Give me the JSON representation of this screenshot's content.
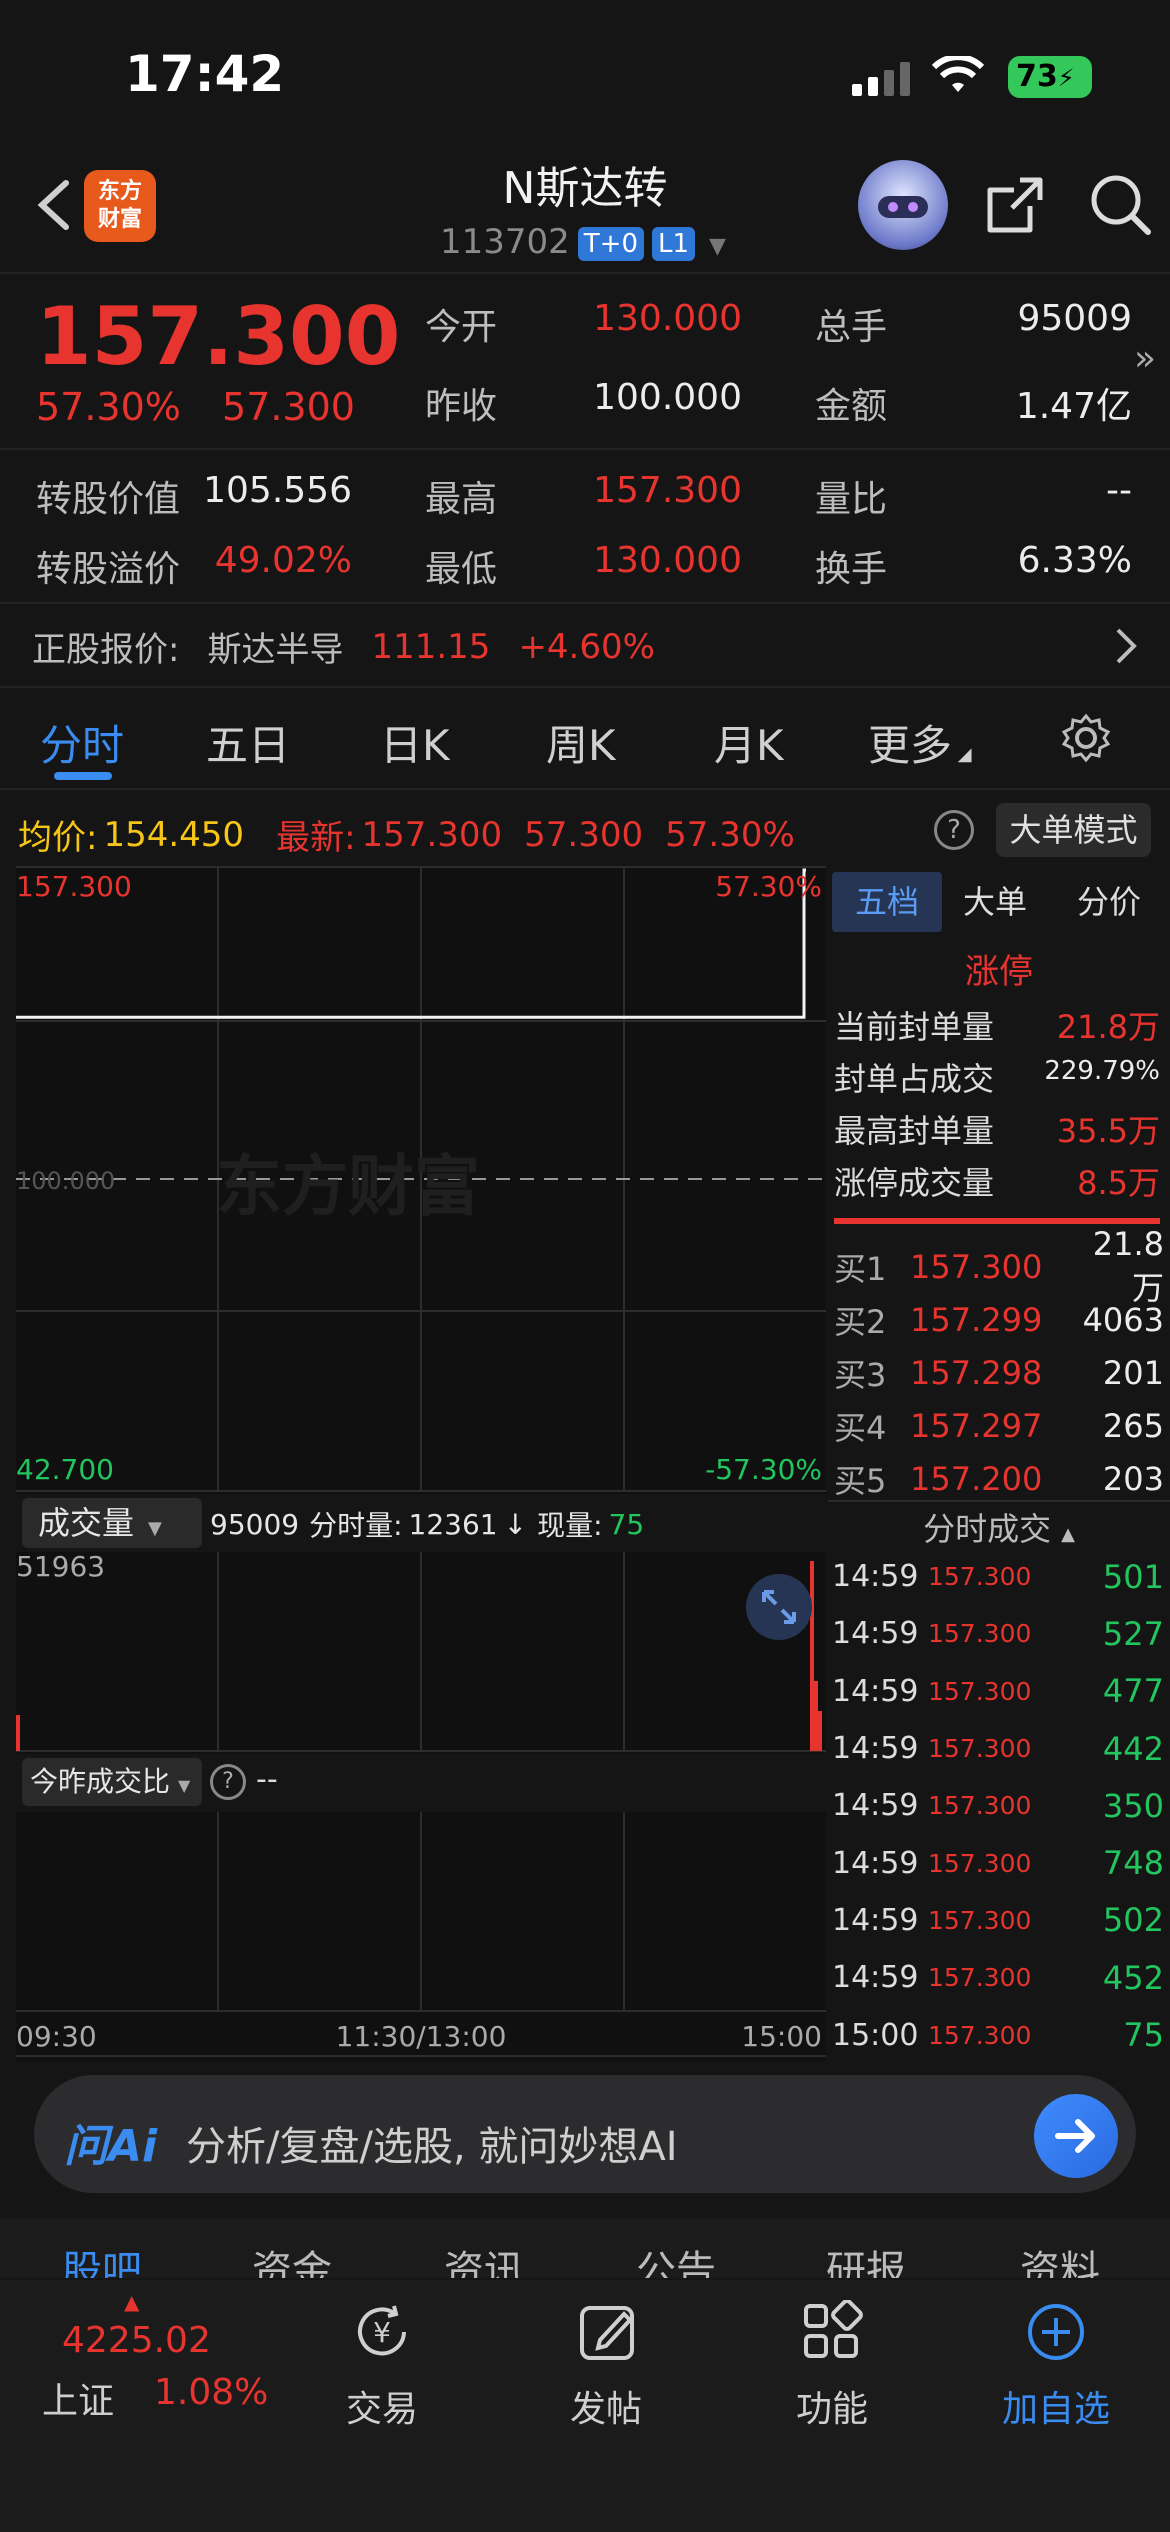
{
  "status": {
    "time": "17:42",
    "battery": "73"
  },
  "header": {
    "title": "N斯达转",
    "code": "113702",
    "tag1": "T+0",
    "tag2": "L1",
    "logo_line1": "东方",
    "logo_line2": "财富"
  },
  "quote": {
    "price": "157.300",
    "change_pct": "57.30%",
    "change_amt": "57.300",
    "open_label": "今开",
    "open": "130.000",
    "total_vol_label": "总手",
    "total_vol": "95009",
    "prev_close_label": "昨收",
    "prev_close": "100.000",
    "amount_label": "金额",
    "amount": "1.47亿",
    "conv_value_label": "转股价值",
    "conv_value": "105.556",
    "high_label": "最高",
    "high": "157.300",
    "vol_ratio_label": "量比",
    "vol_ratio": "--",
    "premium_label": "转股溢价",
    "premium": "49.02%",
    "low_label": "最低",
    "low": "130.000",
    "turnover_label": "换手",
    "turnover": "6.33%"
  },
  "underlying": {
    "label": "正股报价:",
    "name": "斯达半导",
    "price": "111.15",
    "change": "+4.60%"
  },
  "tabs": [
    "分时",
    "五日",
    "日K",
    "周K",
    "月K",
    "更多"
  ],
  "infoline": {
    "avg_label": "均价:",
    "avg": "154.450",
    "latest_label": "最新:",
    "latest": "157.300",
    "chg": "57.300",
    "pct": "57.30%",
    "mode_btn": "大单模式"
  },
  "chart": {
    "top_price": "157.300",
    "top_pct": "57.30%",
    "bottom_price": "42.700",
    "bottom_pct": "-57.30%",
    "mid_price": "100.000",
    "watermark": "东方财富",
    "vol_selector": "成交量",
    "vol_total": "95009",
    "vol_min_label": "分时量:",
    "vol_min": "12361",
    "vol_now_label": "现量:",
    "vol_now": "75",
    "vol_max": "51963",
    "ratio_selector": "今昨成交比",
    "ratio_value": "--",
    "time_start": "09:30",
    "time_mid": "11:30/13:00",
    "time_end": "15:00"
  },
  "chart_data": {
    "type": "line",
    "title": "",
    "x": [
      "09:30",
      "11:30/13:00",
      "15:00"
    ],
    "series": [
      {
        "values": [
          130.0,
          130.0,
          157.3
        ]
      }
    ],
    "ylim": [
      42.7,
      157.3
    ]
  },
  "right": {
    "seg1": "五档",
    "seg2": "大单",
    "seg3": "分价",
    "limit_title": "涨停",
    "seal_label": "当前封单量",
    "seal": "21.8万",
    "seal_ratio_label": "封单占成交",
    "seal_ratio": "229.79%",
    "max_seal_label": "最高封单量",
    "max_seal": "35.5万",
    "limit_vol_label": "涨停成交量",
    "limit_vol": "8.5万",
    "bids": [
      {
        "label": "买1",
        "price": "157.300",
        "vol": "21.8万"
      },
      {
        "label": "买2",
        "price": "157.299",
        "vol": "4063"
      },
      {
        "label": "买3",
        "price": "157.298",
        "vol": "201"
      },
      {
        "label": "买4",
        "price": "157.297",
        "vol": "265"
      },
      {
        "label": "买5",
        "price": "157.200",
        "vol": "203"
      }
    ],
    "ticks_title": "分时成交",
    "ticks": [
      {
        "t": "14:59",
        "p": "157.300",
        "v": "501"
      },
      {
        "t": "14:59",
        "p": "157.300",
        "v": "527"
      },
      {
        "t": "14:59",
        "p": "157.300",
        "v": "477"
      },
      {
        "t": "14:59",
        "p": "157.300",
        "v": "442"
      },
      {
        "t": "14:59",
        "p": "157.300",
        "v": "350"
      },
      {
        "t": "14:59",
        "p": "157.300",
        "v": "748"
      },
      {
        "t": "14:59",
        "p": "157.300",
        "v": "502"
      },
      {
        "t": "14:59",
        "p": "157.300",
        "v": "452"
      },
      {
        "t": "15:00",
        "p": "157.300",
        "v": "75"
      }
    ]
  },
  "ai": {
    "logo": "问Ai",
    "placeholder": "分析/复盘/选股, 就问妙想AI"
  },
  "botnav": [
    "股吧",
    "资金",
    "资讯",
    "公告",
    "研报",
    "资料"
  ],
  "bottom": {
    "index_value": "4225.02",
    "index_name": "上证",
    "index_pct": "1.08%",
    "trade": "交易",
    "post": "发帖",
    "func": "功能",
    "add": "加自选"
  }
}
